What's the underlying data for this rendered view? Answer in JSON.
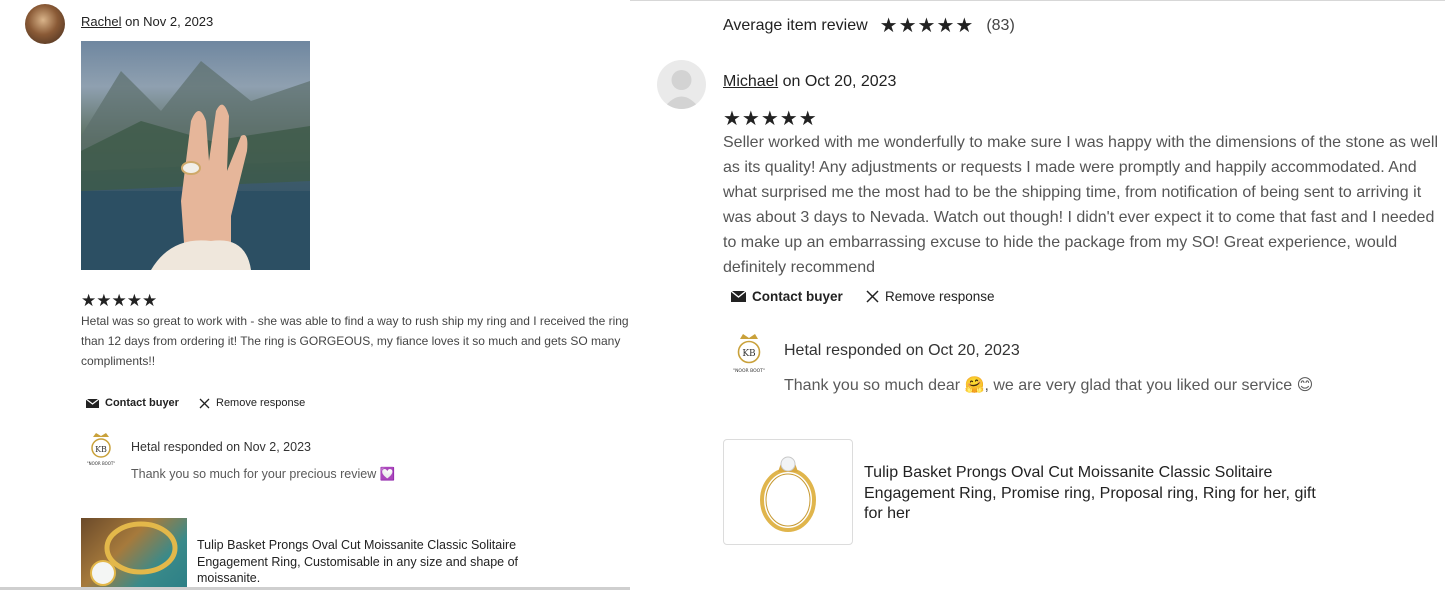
{
  "left": {
    "reviewer_name": "Rachel",
    "review_date": "on Nov 2, 2023",
    "stars": "★★★★★",
    "review_text": "Hetal was so great to work with - she was able to find a way to rush ship my ring and I received the ring less than 12 days from ordering it! The ring is GORGEOUS, my fiance loves it so much and gets SO many compliments!!",
    "contact_buyer_label": "Contact buyer",
    "remove_response_label": "Remove response",
    "response_header": "Hetal responded on Nov 2, 2023",
    "response_text": "Thank you so much for your precious review 💟",
    "product_title": "Tulip Basket Prongs Oval Cut Moissanite Classic Solitaire Engagement Ring, Customisable in any size and shape of moissanite."
  },
  "right": {
    "average_label": "Average item review",
    "average_stars": "★★★★★",
    "review_count": "(83)",
    "reviewer_name": "Michael",
    "review_date": "on Oct 20, 2023",
    "stars": "★★★★★",
    "review_text": "Seller worked with me wonderfully to make sure I was happy with the dimensions of the stone as well as its quality! Any adjustments or requests I made were promptly and happily accommodated. And what surprised me the most had to be the shipping time, from notification of being sent to arriving it was about 3 days to Nevada. Watch out though! I didn't ever expect it to come that fast and I needed to make up an embarrassing excuse to hide the package from my SO! Great experience, would definitely recommend",
    "contact_buyer_label": "Contact buyer",
    "remove_response_label": "Remove response",
    "response_header": "Hetal responded on Oct 20, 2023",
    "response_text": "Thank you so much dear 🤗, we are very glad that you liked our service 😊",
    "product_title": "Tulip Basket Prongs Oval Cut Moissanite Classic Solitaire Engagement Ring, Promise ring, Proposal ring, Ring for her, gift for her"
  },
  "shop_logo": {
    "initials": "KB",
    "tagline": "\"NOOR BOOT\""
  }
}
